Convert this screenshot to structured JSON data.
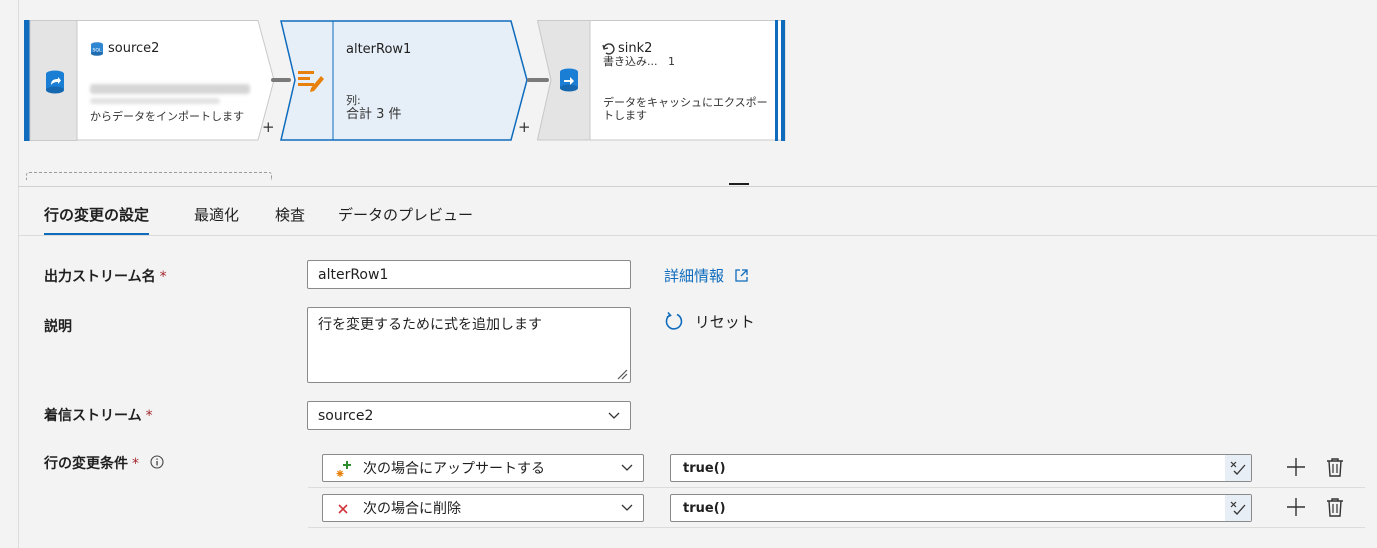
{
  "flow": {
    "source": {
      "title": "source2",
      "desc": "からデータをインポートします"
    },
    "alter": {
      "title": "alterRow1",
      "cols_label": "列:",
      "cols_value": "合計 3 件"
    },
    "sink": {
      "title": "sink2",
      "sub": "書き込み...",
      "sub_count": "1",
      "desc": "データをキャッシュにエクスポートします"
    },
    "plus": "+"
  },
  "tabs": [
    "行の変更の設定",
    "最適化",
    "検査",
    "データのプレビュー"
  ],
  "form": {
    "stream_name_label": "出力ストリーム名",
    "stream_name_value": "alterRow1",
    "details_link": "詳細情報",
    "desc_label": "説明",
    "desc_value": "行を変更するために式を追加します",
    "reset_label": "リセット",
    "incoming_label": "着信ストリーム",
    "incoming_value": "source2",
    "conditions_label": "行の変更条件",
    "required_mark": "*"
  },
  "conditions": [
    {
      "action": "次の場合にアップサートする",
      "expr": "true()",
      "icon": "upsert-icon"
    },
    {
      "action": "次の場合に削除",
      "expr": "true()",
      "icon": "delete-x-icon"
    }
  ],
  "colors": {
    "accent": "#0f6cbd",
    "node_edge": "#0f6cbd",
    "required": "#a4262c",
    "alter_icon": "#e8810c"
  }
}
